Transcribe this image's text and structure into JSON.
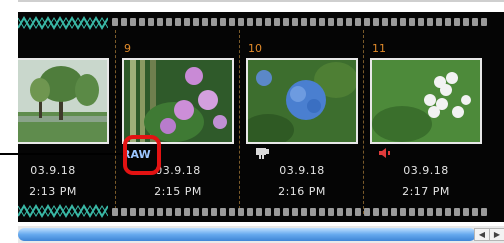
{
  "frames": [
    {
      "number": "",
      "date": "03.9.18",
      "time": "2:13 PM",
      "badge": ""
    },
    {
      "number": "9",
      "date": "03.9.18",
      "time": "2:15 PM",
      "badge": "RAW"
    },
    {
      "number": "10",
      "date": "03.9.18",
      "time": "2:16 PM",
      "badge": "movie-icon"
    },
    {
      "number": "11",
      "date": "03.9.18",
      "time": "2:17 PM",
      "badge": "sound-icon"
    }
  ],
  "colors": {
    "highlight": "#e31212",
    "frame_number": "#e18a2a",
    "raw_label": "#9cc6ff",
    "scrollbar": "#4f93e0"
  },
  "scrollbar": {
    "left_arrow": "◀",
    "right_arrow": "▶"
  }
}
